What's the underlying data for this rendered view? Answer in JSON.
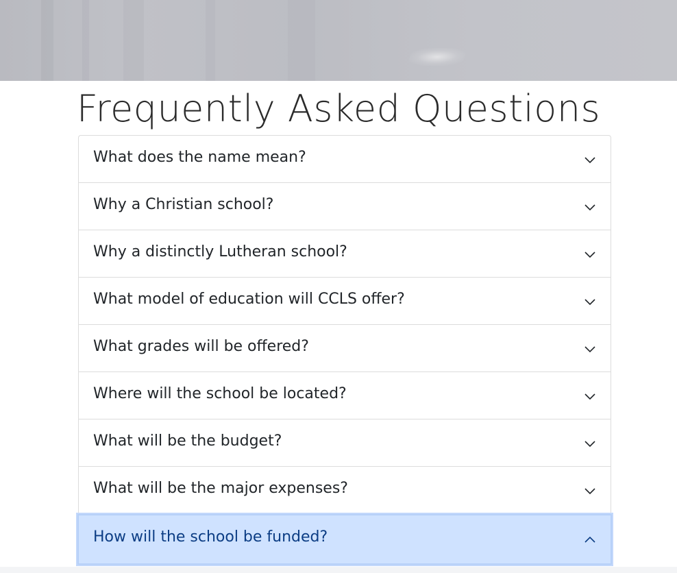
{
  "page": {
    "title": "Frequently Asked Questions"
  },
  "faq": {
    "items": [
      {
        "question": "What does the name mean?",
        "expanded": false
      },
      {
        "question": "Why a Christian school?",
        "expanded": false
      },
      {
        "question": "Why a distinctly Lutheran school?",
        "expanded": false
      },
      {
        "question": "What model of education will CCLS offer?",
        "expanded": false
      },
      {
        "question": "What grades will be offered?",
        "expanded": false
      },
      {
        "question": "Where will the school be located?",
        "expanded": false
      },
      {
        "question": "What will be the budget?",
        "expanded": false
      },
      {
        "question": "What will be the major expenses?",
        "expanded": false
      },
      {
        "question": "How will the school be funded?",
        "expanded": true
      }
    ]
  },
  "icons": {
    "collapsed": "chevron-down-icon",
    "expanded": "chevron-up-icon"
  },
  "colors": {
    "active_background": "#cfe2ff",
    "active_text": "#0c3d84",
    "text": "#212529",
    "border": "#dcdcdc"
  }
}
